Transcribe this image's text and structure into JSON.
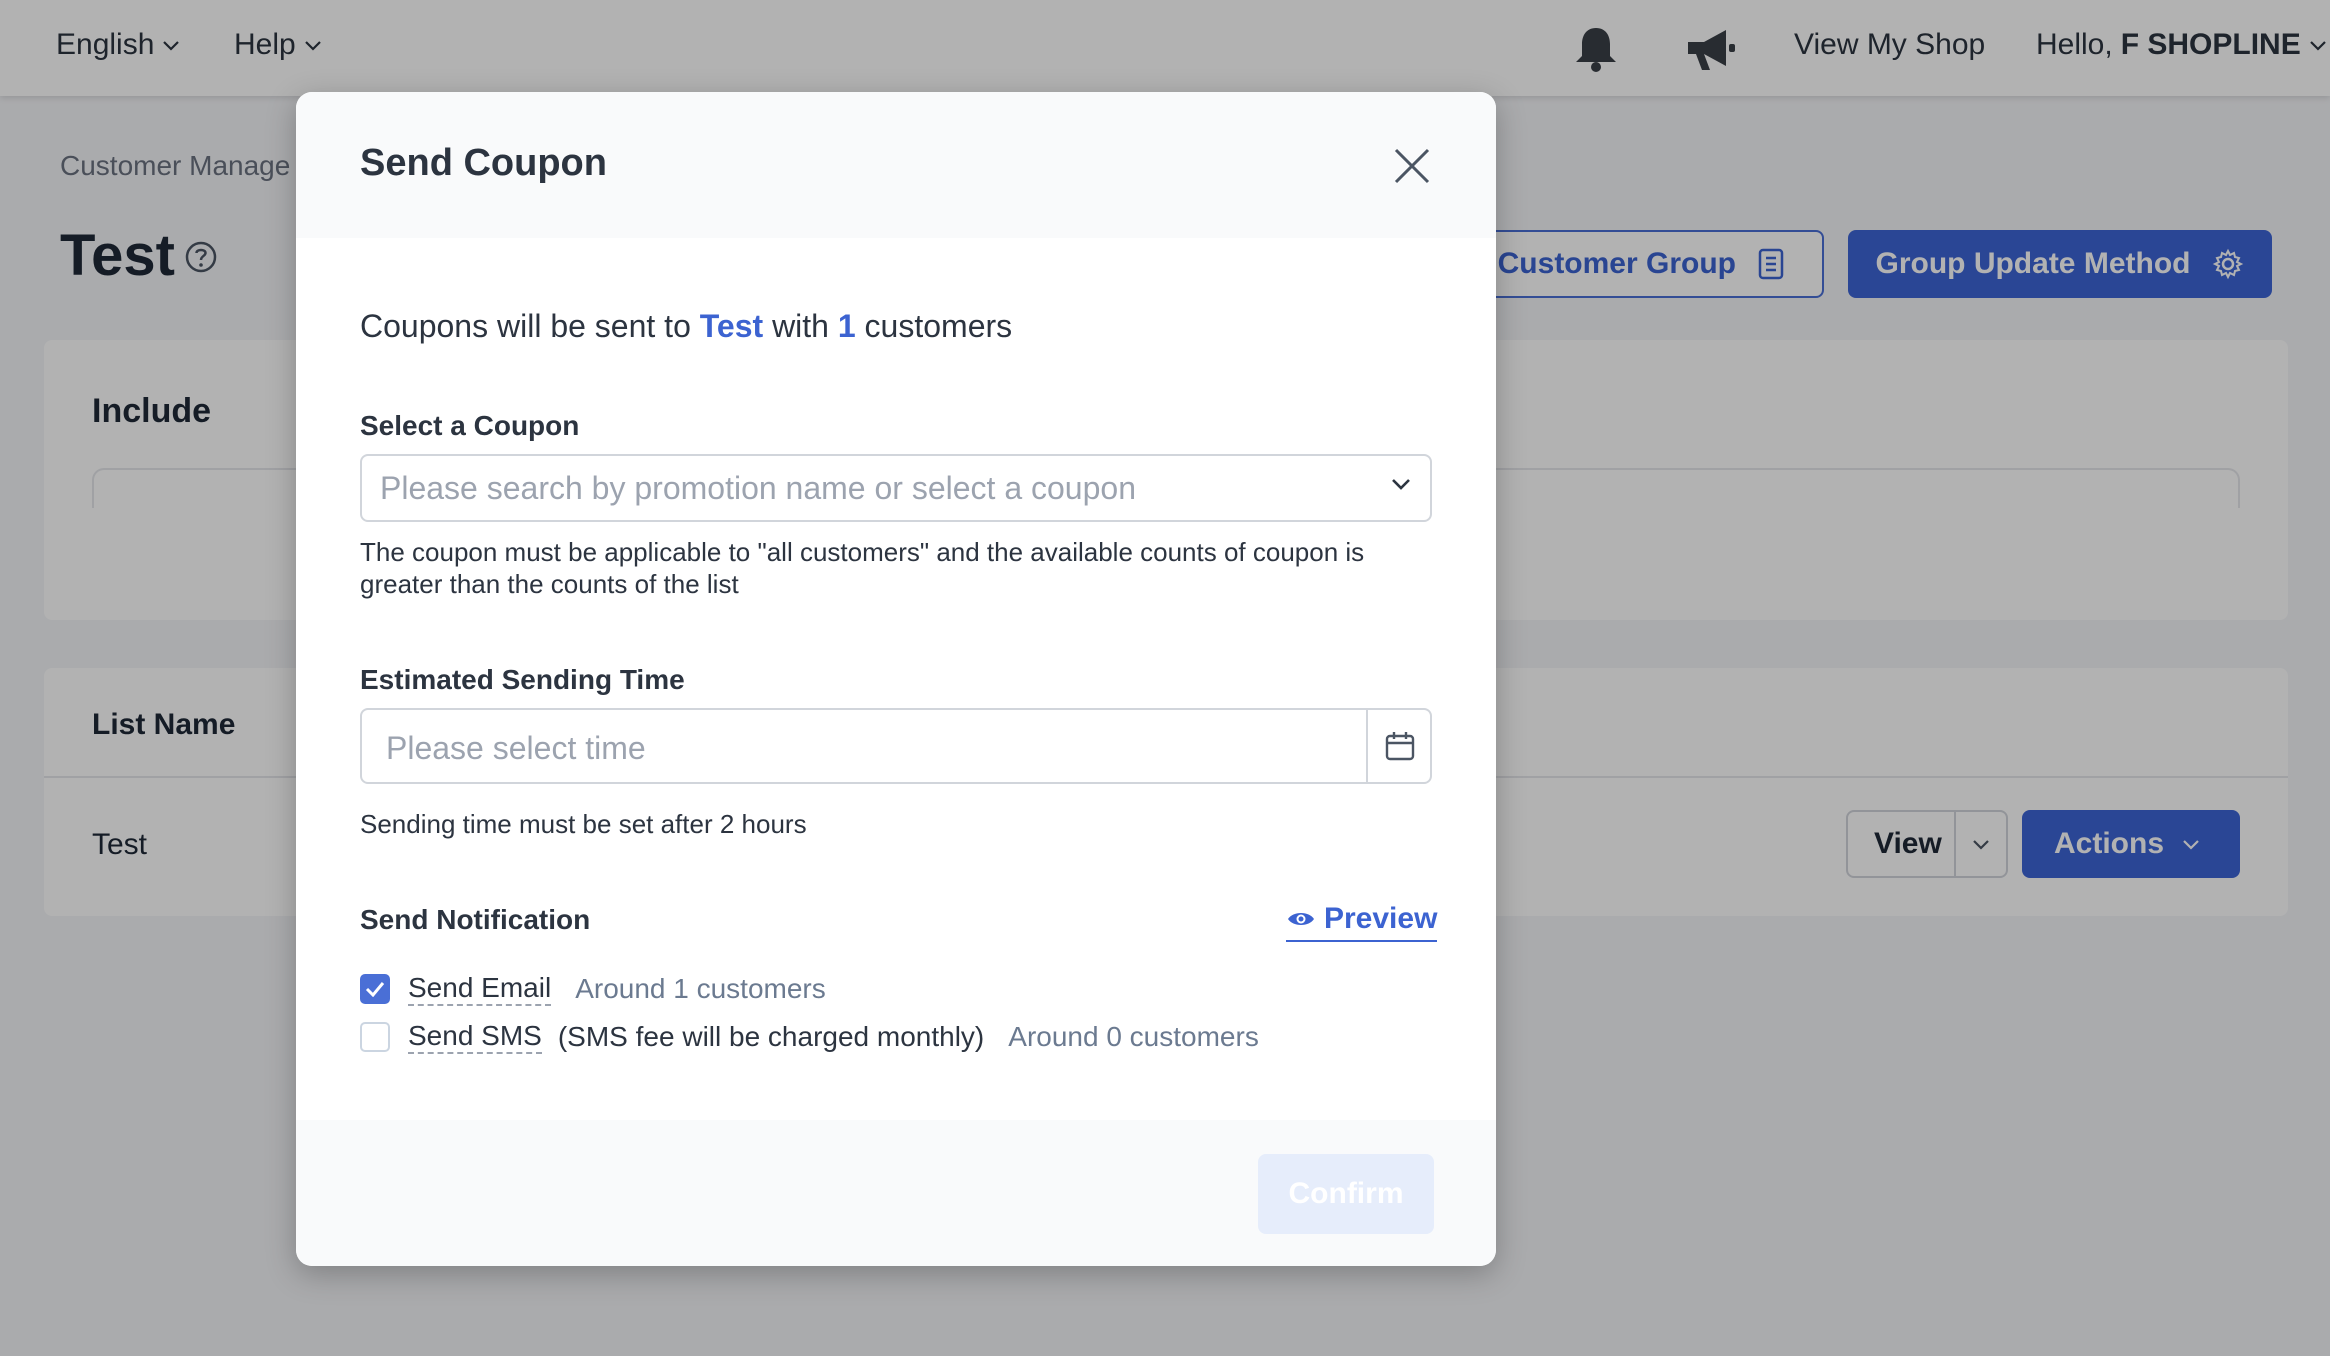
{
  "topbar": {
    "language": "English",
    "help": "Help",
    "view_shop": "View My Shop",
    "hello_prefix": "Hello,",
    "user_name": "F SHOPLINE"
  },
  "page": {
    "breadcrumb": "Customer Manage",
    "title": "Test",
    "btn_customer_group": "e Customer Group",
    "btn_update_method": "Group Update Method",
    "include_label": "Include",
    "list_name_header": "List Name",
    "row_name": "Test",
    "view_label": "View",
    "actions_label": "Actions"
  },
  "modal": {
    "title": "Send Coupon",
    "intro_prefix": "Coupons will be sent to",
    "intro_group": "Test",
    "intro_mid": "with",
    "intro_count": "1",
    "intro_suffix": "customers",
    "coupon_label": "Select a Coupon",
    "coupon_placeholder": "Please search by promotion name or select a coupon",
    "coupon_hint": "The coupon must be applicable to \"all customers\" and the available counts of coupon is greater than the counts of the list",
    "time_label": "Estimated Sending Time",
    "time_placeholder": "Please select time",
    "time_hint": "Sending time must be set after 2 hours",
    "notify_label": "Send Notification",
    "preview_label": "Preview",
    "send_email": "Send Email",
    "email_count": "Around 1 customers",
    "send_sms": "Send SMS",
    "sms_note": "(SMS fee will be charged monthly)",
    "sms_count": "Around 0 customers",
    "confirm_label": "Confirm"
  },
  "colors": {
    "accent": "#3d65d6",
    "link": "#3c63d1",
    "overlay": "rgba(0,0,0,0.30)"
  }
}
